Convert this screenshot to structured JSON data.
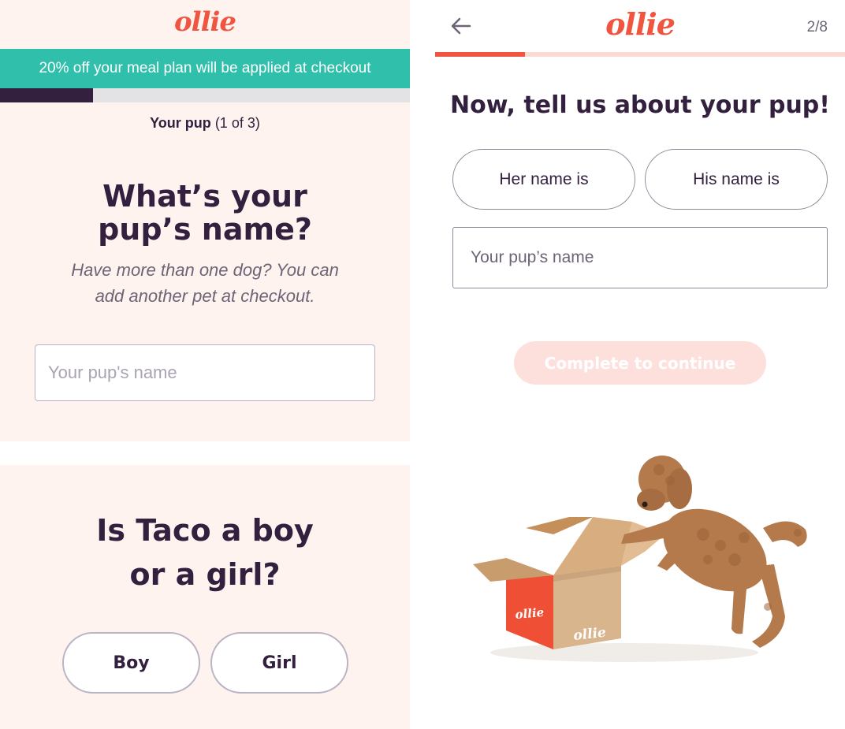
{
  "left": {
    "logo": "ollie",
    "promo_banner": "20% off your meal plan will be applied at checkout",
    "progress": 0.227,
    "step_name": "Your pup",
    "step_count": "(1 of 3)",
    "question_line1": "What’s your",
    "question_line2": "pup’s name?",
    "subtext_line1": "Have more than one dog? You can",
    "subtext_line2": "add another pet at checkout.",
    "name_placeholder": "Your pup's name",
    "gender_question_line1": "Is Taco a boy",
    "gender_question_line2": "or a girl?",
    "boy_label": "Boy",
    "girl_label": "Girl"
  },
  "right": {
    "logo": "ollie",
    "step_counter": "2/8",
    "progress": 0.22,
    "title": "Now, tell us about your pup!",
    "her_label": "Her name is",
    "his_label": "His name is",
    "name_placeholder": "Your pup’s name",
    "continue_label": "Complete to continue",
    "box_brand": "ollie"
  },
  "colors": {
    "brand": "#f0553f",
    "navy": "#33203f",
    "teal": "#2fbfab",
    "blush": "#fff3f0",
    "disabled_button": "#fde0dc"
  },
  "icons": {
    "back": "back-arrow-icon"
  }
}
